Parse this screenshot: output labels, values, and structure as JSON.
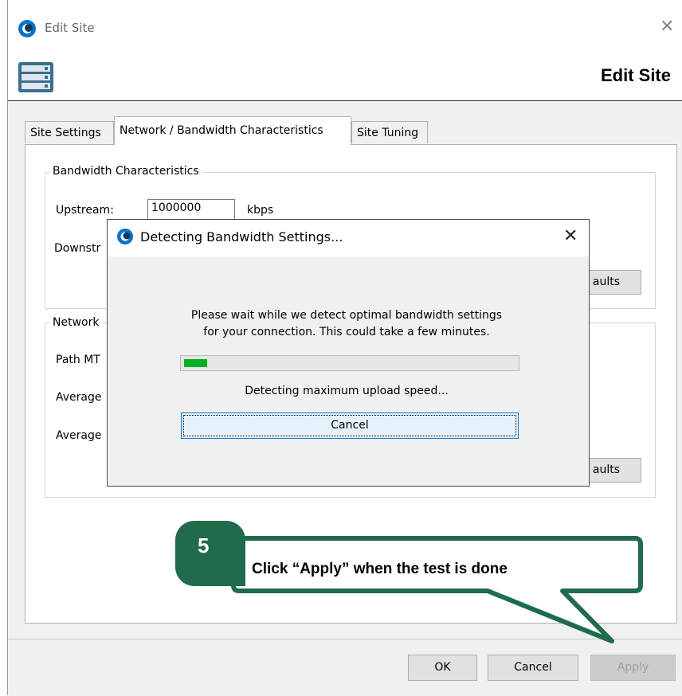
{
  "window": {
    "title": "Edit Site",
    "header_title": "Edit Site"
  },
  "tabs": [
    {
      "label": "Site Settings"
    },
    {
      "label": "Network / Bandwidth Characteristics"
    },
    {
      "label": "Site Tuning"
    }
  ],
  "bandwidth_group": {
    "label": "Bandwidth Characteristics",
    "upstream_label": "Upstream:",
    "upstream_value": "1000000",
    "upstream_unit": "kbps",
    "downstream_label_visible": "Downstr",
    "defaults_button_visible": "aults"
  },
  "network_group": {
    "label_visible": "Network",
    "path_mtu_visible": "Path MT",
    "average1_visible": "Average",
    "average2_visible": "Average",
    "defaults_button_visible": "aults"
  },
  "dialog": {
    "title": "Detecting Bandwidth Settings...",
    "message_line1": "Please wait while we detect optimal bandwidth settings",
    "message_line2": "for your connection. This could take a few minutes.",
    "progress_percent": 7,
    "status": "Detecting maximum upload speed...",
    "cancel_label": "Cancel"
  },
  "footer": {
    "ok_label": "OK",
    "cancel_label": "Cancel",
    "apply_label": "Apply"
  },
  "callout": {
    "step": "5",
    "text": "Click “Apply” when the test is done",
    "color": "#1f6b4c"
  },
  "colors": {
    "progress": "#06b025",
    "focus_border": "#0078d7"
  }
}
